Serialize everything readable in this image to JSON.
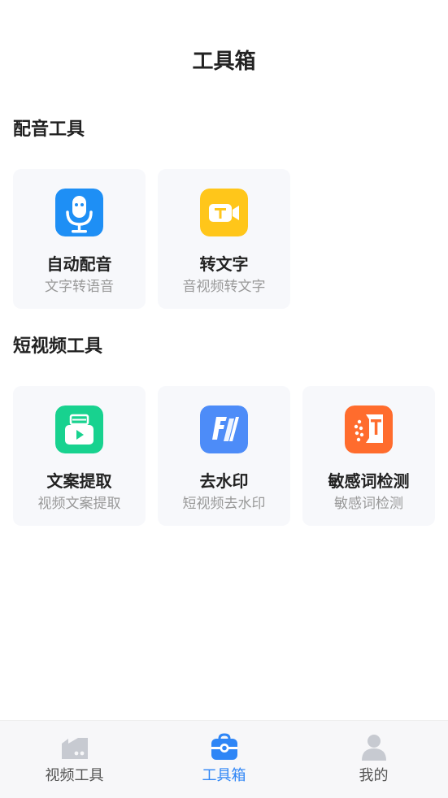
{
  "header": {
    "title": "工具箱"
  },
  "sections": [
    {
      "title": "配音工具",
      "tools": [
        {
          "title": "自动配音",
          "subtitle": "文字转语音",
          "icon": "microphone-icon",
          "color": "#1e8ff5"
        },
        {
          "title": "转文字",
          "subtitle": "音视频转文字",
          "icon": "video-to-text-icon",
          "color": "#ffc61a"
        }
      ]
    },
    {
      "title": "短视频工具",
      "tools": [
        {
          "title": "文案提取",
          "subtitle": "视频文案提取",
          "icon": "copy-extract-icon",
          "color": "#18d28f"
        },
        {
          "title": "去水印",
          "subtitle": "短视频去水印",
          "icon": "watermark-remove-icon",
          "color": "#4d8cf8"
        },
        {
          "title": "敏感词检测",
          "subtitle": "敏感词检测",
          "icon": "sensitive-word-icon",
          "color": "#ff6c2d"
        }
      ]
    }
  ],
  "bottom_nav": {
    "items": [
      {
        "label": "视频工具",
        "icon": "video-camera-icon",
        "active": false
      },
      {
        "label": "工具箱",
        "icon": "toolbox-icon",
        "active": true
      },
      {
        "label": "我的",
        "icon": "profile-icon",
        "active": false
      }
    ],
    "active_color": "#2f86f6",
    "inactive_color": "#555555"
  }
}
